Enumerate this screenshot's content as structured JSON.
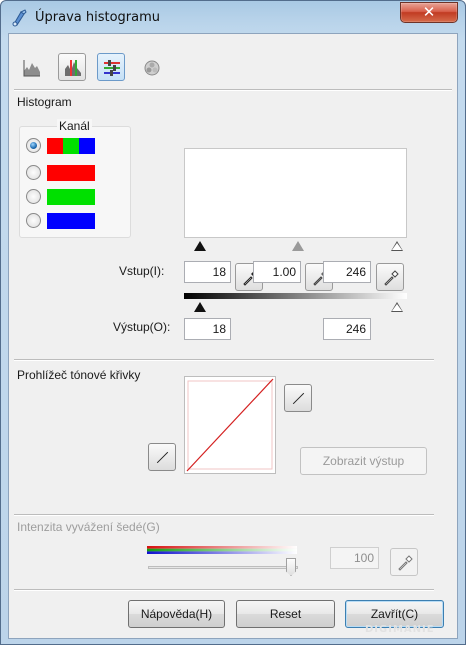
{
  "window": {
    "title": "Úprava histogramu",
    "close_glyph": "✕"
  },
  "toolbar": {
    "buttons": [
      {
        "icon": "histogram-icon",
        "state": "normal"
      },
      {
        "icon": "histogram-adjust-icon",
        "state": "framed"
      },
      {
        "icon": "color-adjust-icon",
        "state": "active"
      },
      {
        "icon": "color-wheel-icon",
        "state": "normal"
      }
    ]
  },
  "histogram": {
    "section_label": "Histogram",
    "channel_label": "Kanál",
    "channels": [
      {
        "name": "rgb",
        "colors": [
          "#ff0000",
          "#00e000",
          "#0000ff"
        ],
        "checked": true
      },
      {
        "name": "red",
        "colors": [
          "#ff0000"
        ],
        "checked": false
      },
      {
        "name": "green",
        "colors": [
          "#00e000"
        ],
        "checked": false
      },
      {
        "name": "blue",
        "colors": [
          "#0000ff"
        ],
        "checked": false
      }
    ],
    "input_label": "Vstup(I):",
    "input_shadow": "18",
    "input_gamma": "1.00",
    "input_highlight": "246",
    "output_label": "Výstup(O):",
    "output_shadow": "18",
    "output_highlight": "246"
  },
  "tone_curve": {
    "section_label": "Prohlížeč tónové křivky",
    "show_output_label": "Zobrazit výstup"
  },
  "gray_balance": {
    "label": "Intenzita vyvážení šedé(G)",
    "value": "100",
    "slider_level": 1.0
  },
  "footer": {
    "help_label": "Nápověda(H)",
    "reset_label": "Reset",
    "close_label": "Zavřít(C)"
  },
  "watermark": "DIGIMANIE"
}
